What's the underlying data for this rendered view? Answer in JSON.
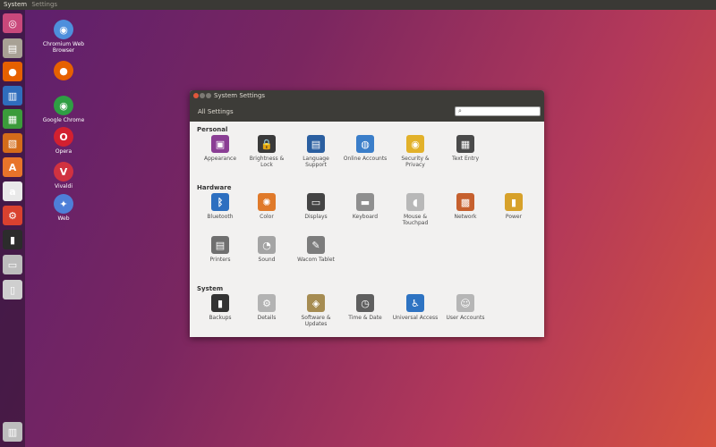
{
  "topbar": {
    "app": "System",
    "subtitle": "Settings"
  },
  "launcher": [
    {
      "name": "dash-icon",
      "glyph": "◎",
      "color": "#c9487b"
    },
    {
      "name": "files-icon",
      "glyph": "▤",
      "color": "#a8a195"
    },
    {
      "name": "firefox-icon",
      "glyph": "●",
      "color": "#e66000"
    },
    {
      "name": "writer-icon",
      "glyph": "▥",
      "color": "#2f6dbd"
    },
    {
      "name": "calc-icon",
      "glyph": "▦",
      "color": "#3b9b3b"
    },
    {
      "name": "impress-icon",
      "glyph": "▧",
      "color": "#d46b1a"
    },
    {
      "name": "software-center-icon",
      "glyph": "A",
      "color": "#e8742a"
    },
    {
      "name": "amazon-icon",
      "glyph": "a",
      "color": "#e9e9e9"
    },
    {
      "name": "system-settings-icon",
      "glyph": "⚙",
      "color": "#d9412f"
    },
    {
      "name": "terminal-icon",
      "glyph": "▮",
      "color": "#2c2c2c"
    },
    {
      "name": "drive-icon",
      "glyph": "▭",
      "color": "#bdbdbd"
    },
    {
      "name": "usb-icon",
      "glyph": "▯",
      "color": "#cfcfcf"
    },
    {
      "name": "trash-icon",
      "glyph": "▥",
      "color": "#bdbdbd"
    }
  ],
  "desktop": [
    {
      "label": "Chromium Web Browser",
      "glyph": "◉",
      "color": "#4e8fdc"
    },
    {
      "label": "",
      "glyph": "●",
      "color": "#e66000"
    },
    {
      "label": "Google Chrome",
      "glyph": "◉",
      "color": "#2f9e44"
    },
    {
      "label": "Opera",
      "glyph": "O",
      "color": "#d22030"
    },
    {
      "label": "Vivaldi",
      "glyph": "V",
      "color": "#d03240"
    },
    {
      "label": "Web",
      "glyph": "✦",
      "color": "#4e7fd8"
    }
  ],
  "window": {
    "title": "System Settings",
    "toolbar_label": "All Settings",
    "search_value": "",
    "sections": [
      {
        "title": "Personal",
        "items": [
          {
            "label": "Appearance",
            "glyph": "▣",
            "color": "#8a3e94",
            "icon": "appearance-icon"
          },
          {
            "label": "Brightness & Lock",
            "glyph": "🔒",
            "color": "#3a3a3a",
            "icon": "brightness-lock-icon"
          },
          {
            "label": "Language Support",
            "glyph": "▤",
            "color": "#2b5fa0",
            "icon": "language-support-icon"
          },
          {
            "label": "Online Accounts",
            "glyph": "◍",
            "color": "#3b7ec9",
            "icon": "online-accounts-icon"
          },
          {
            "label": "Security & Privacy",
            "glyph": "◉",
            "color": "#e2b12a",
            "icon": "security-privacy-icon"
          },
          {
            "label": "Text Entry",
            "glyph": "▦",
            "color": "#4a4a4a",
            "icon": "text-entry-icon"
          }
        ]
      },
      {
        "title": "Hardware",
        "items": [
          {
            "label": "Bluetooth",
            "glyph": "ᛒ",
            "color": "#2d6fc0",
            "icon": "bluetooth-icon"
          },
          {
            "label": "Color",
            "glyph": "✺",
            "color": "#e07a2a",
            "icon": "color-icon"
          },
          {
            "label": "Displays",
            "glyph": "▭",
            "color": "#444444",
            "icon": "displays-icon"
          },
          {
            "label": "Keyboard",
            "glyph": "▬",
            "color": "#8f8f8f",
            "icon": "keyboard-icon"
          },
          {
            "label": "Mouse & Touchpad",
            "glyph": "◖",
            "color": "#b8b8b8",
            "icon": "mouse-touchpad-icon"
          },
          {
            "label": "Network",
            "glyph": "▩",
            "color": "#c6602e",
            "icon": "network-icon"
          },
          {
            "label": "Power",
            "glyph": "▮",
            "color": "#d7a12a",
            "icon": "power-icon"
          },
          {
            "label": "Printers",
            "glyph": "▤",
            "color": "#6f6f6f",
            "icon": "printers-icon"
          },
          {
            "label": "Sound",
            "glyph": "◔",
            "color": "#a4a4a4",
            "icon": "sound-icon"
          },
          {
            "label": "Wacom Tablet",
            "glyph": "✎",
            "color": "#7c7c7c",
            "icon": "wacom-tablet-icon"
          }
        ]
      },
      {
        "title": "System",
        "items": [
          {
            "label": "Backups",
            "glyph": "▮",
            "color": "#333333",
            "icon": "backups-icon"
          },
          {
            "label": "Details",
            "glyph": "⚙",
            "color": "#b3b3b3",
            "icon": "details-icon"
          },
          {
            "label": "Software & Updates",
            "glyph": "◈",
            "color": "#a68c52",
            "icon": "software-updates-icon"
          },
          {
            "label": "Time & Date",
            "glyph": "◷",
            "color": "#5f5f5f",
            "icon": "time-date-icon"
          },
          {
            "label": "Universal Access",
            "glyph": "♿",
            "color": "#2e73c2",
            "icon": "universal-access-icon"
          },
          {
            "label": "User Accounts",
            "glyph": "☺",
            "color": "#b6b6b6",
            "icon": "user-accounts-icon"
          }
        ]
      }
    ]
  }
}
